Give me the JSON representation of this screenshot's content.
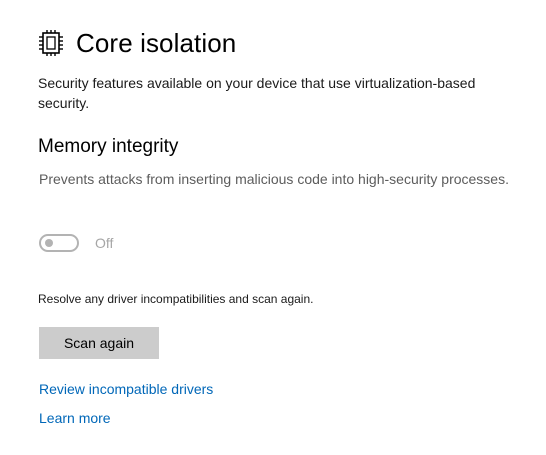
{
  "header": {
    "icon": "chip-icon",
    "title": "Core isolation"
  },
  "intro": {
    "text": "Security features available on your device that use virtualization-based security."
  },
  "memory_integrity": {
    "heading": "Memory integrity",
    "description": "Prevents attacks from inserting malicious code into high-security processes.",
    "toggle_state": "Off"
  },
  "resolve": {
    "text": "Resolve any driver incompatibilities and scan again.",
    "scan_button_label": "Scan again"
  },
  "links": {
    "review_drivers": "Review incompatible drivers",
    "learn_more": "Learn more"
  },
  "colors": {
    "link": "#0067b8",
    "button_bg": "#cccccc",
    "toggle_disabled": "#b3b3b3"
  }
}
